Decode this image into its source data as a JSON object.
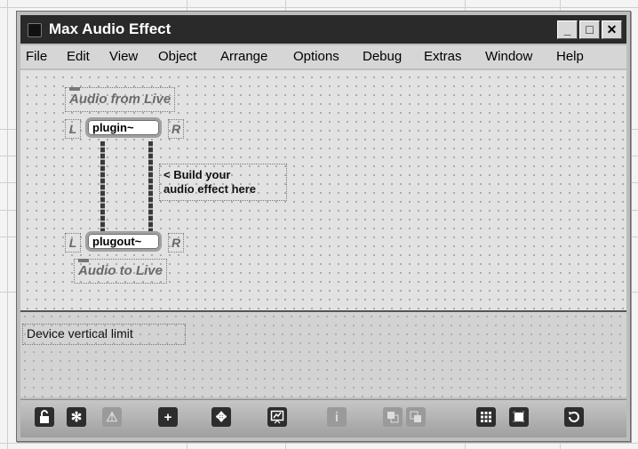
{
  "window": {
    "title": "Max Audio Effect",
    "controls": {
      "minimize": "_",
      "maximize": "□",
      "close": "✕"
    }
  },
  "menubar": {
    "items": [
      "File",
      "Edit",
      "View",
      "Object",
      "Arrange",
      "Options",
      "Debug",
      "Extras",
      "Window",
      "Help"
    ]
  },
  "patcher": {
    "audio_from_live": "Audio from Live",
    "audio_to_live": "Audio to Live",
    "left_label": "L",
    "right_label": "R",
    "plugin_object": "plugin~",
    "plugout_object": "plugout~",
    "build_note_line1": "< Build your",
    "build_note_line2": "audio effect here",
    "device_limit": "Device vertical limit"
  },
  "toolbar": {
    "buttons": [
      "lock-icon",
      "freeze-icon",
      "warning-icon",
      "new-object-icon",
      "move-icon",
      "presentation-icon",
      "inspector-icon",
      "bring-front-icon",
      "send-back-icon",
      "grid-icon",
      "snap-icon",
      "refresh-icon"
    ]
  }
}
